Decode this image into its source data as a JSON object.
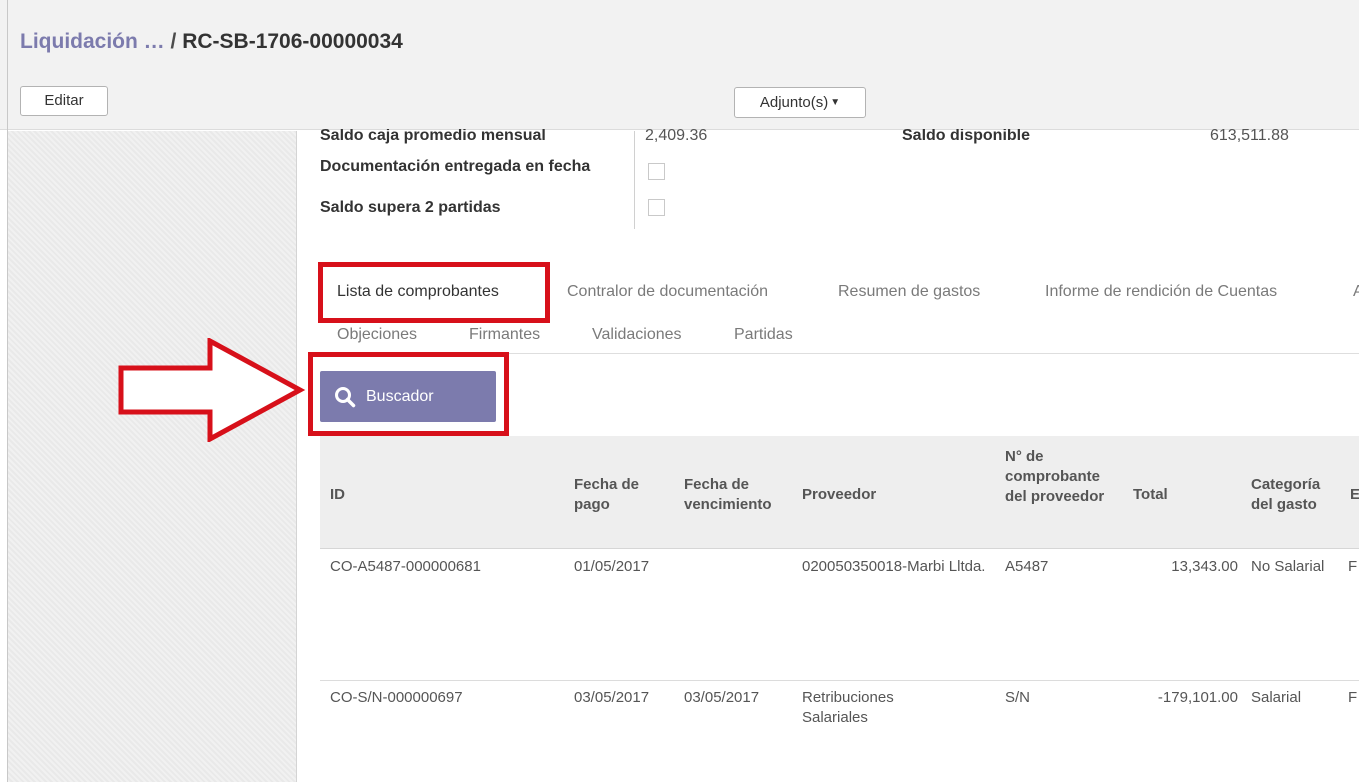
{
  "breadcrumb": {
    "parent": "Liquidación …",
    "separator": "/",
    "current": "RC-SB-1706-00000034"
  },
  "toolbar": {
    "edit_label": "Editar",
    "attachments_label": "Adjunto(s)"
  },
  "form": {
    "saldo_caja_label": "Saldo caja promedio mensual",
    "saldo_caja_value": "2,409.36",
    "saldo_disponible_label": "Saldo disponible",
    "saldo_disponible_value": "613,511.88",
    "documentacion_label": "Documentación entregada en fecha",
    "saldo_supera_label": "Saldo supera 2 partidas",
    "documentacion_checked": false,
    "saldo_supera_checked": false
  },
  "tabs": [
    {
      "label": "Lista de comprobantes",
      "active": true
    },
    {
      "label": "Contralor de documentación",
      "active": false
    },
    {
      "label": "Resumen de gastos",
      "active": false
    },
    {
      "label": "Informe de rendición de Cuentas",
      "active": false
    },
    {
      "label": "A",
      "active": false
    },
    {
      "label": "Objeciones",
      "active": false
    },
    {
      "label": "Firmantes",
      "active": false
    },
    {
      "label": "Validaciones",
      "active": false
    },
    {
      "label": "Partidas",
      "active": false
    }
  ],
  "search_button": {
    "label": "Buscador",
    "icon": "search-icon"
  },
  "table": {
    "columns": [
      "ID",
      "Fecha de pago",
      "Fecha de vencimiento",
      "Proveedor",
      "N° de comprobante del proveedor",
      "Total",
      "Categoría del gasto",
      "E"
    ],
    "rows": [
      [
        "CO-A5487-000000681",
        "01/05/2017",
        "",
        "020050350018-Marbi Lltda.",
        "A5487",
        "13,343.00",
        "No Salarial",
        "F"
      ],
      [
        "CO-S/N-000000697",
        "03/05/2017",
        "03/05/2017",
        "Retribuciones Salariales",
        "S/N",
        "-179,101.00",
        "Salarial",
        "F"
      ]
    ]
  },
  "colors": {
    "accent": "#7c7bad",
    "highlight": "#d7101a",
    "header_bg": "#eeeeee"
  }
}
